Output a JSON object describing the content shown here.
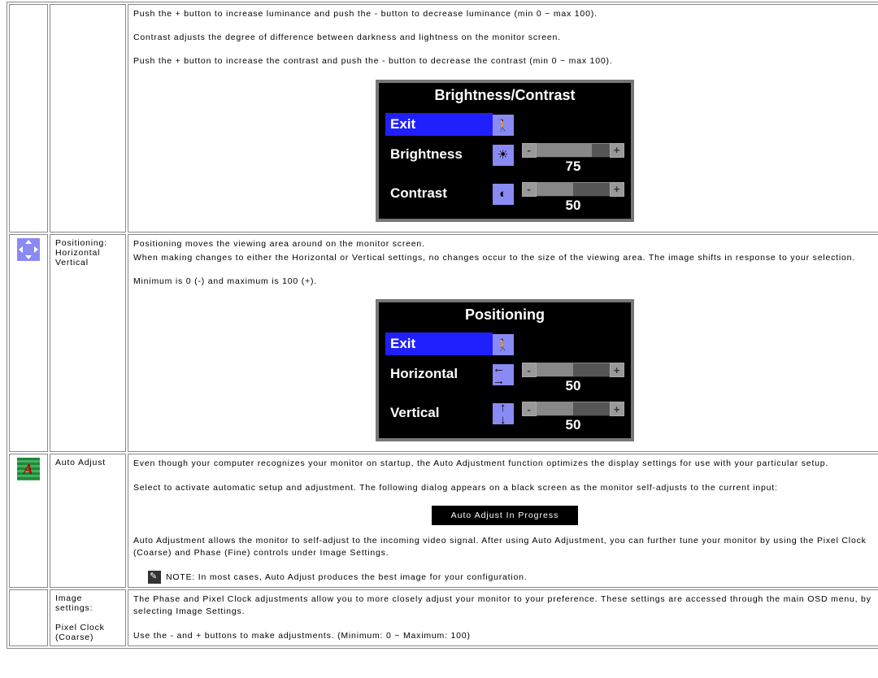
{
  "row1": {
    "p1": "Push the + button to increase luminance and push the - button to decrease luminance (min 0 ~ max 100).",
    "p2": "Contrast adjusts the degree of difference between darkness and lightness on the monitor screen.",
    "p3": "Push the + button to increase the contrast and push the - button to decrease the contrast (min 0 ~ max 100).",
    "osd": {
      "title": "Brightness/Contrast",
      "exit": "Exit",
      "brightness_label": "Brightness",
      "brightness_value": "75",
      "contrast_label": "Contrast",
      "contrast_value": "50"
    }
  },
  "row2": {
    "label_l1": "Positioning:",
    "label_l2": "Horizontal",
    "label_l3": "Vertical",
    "p1": "Positioning moves the viewing area around on the monitor screen.",
    "p2": "When making changes to either the Horizontal or Vertical settings, no changes occur to the size of the viewing area. The image shifts in response to your selection.",
    "p3": "Minimum is 0 (-) and maximum is 100 (+).",
    "osd": {
      "title": "Positioning",
      "exit": "Exit",
      "horizontal_label": "Horizontal",
      "horizontal_value": "50",
      "vertical_label": "Vertical",
      "vertical_value": "50"
    }
  },
  "row3": {
    "label": "Auto Adjust",
    "p1": "Even though your computer recognizes your monitor on startup, the Auto Adjustment function optimizes the display settings for use with your particular setup.",
    "p2": "Select to activate automatic setup and adjustment. The following dialog appears on a black screen as the monitor self-adjusts to the current input:",
    "pill": "Auto Adjust In Progress",
    "p3": "Auto Adjustment allows the monitor to self-adjust to the incoming video signal. After using Auto Adjustment, you can further tune your monitor by using the Pixel Clock (Coarse) and Phase (Fine) controls under Image Settings.",
    "note": "NOTE: In most cases, Auto Adjust produces the best image for your configuration."
  },
  "row4": {
    "label_l1": "Image",
    "label_l2": "settings:",
    "label_l3": "Pixel Clock",
    "label_l4": "(Coarse)",
    "p1": "The Phase and Pixel Clock adjustments allow you to more closely adjust your monitor to your preference. These settings are accessed through the main OSD menu, by selecting Image Settings.",
    "p2": "Use the - and + buttons to make adjustments. (Minimum: 0 ~ Maximum: 100)"
  }
}
